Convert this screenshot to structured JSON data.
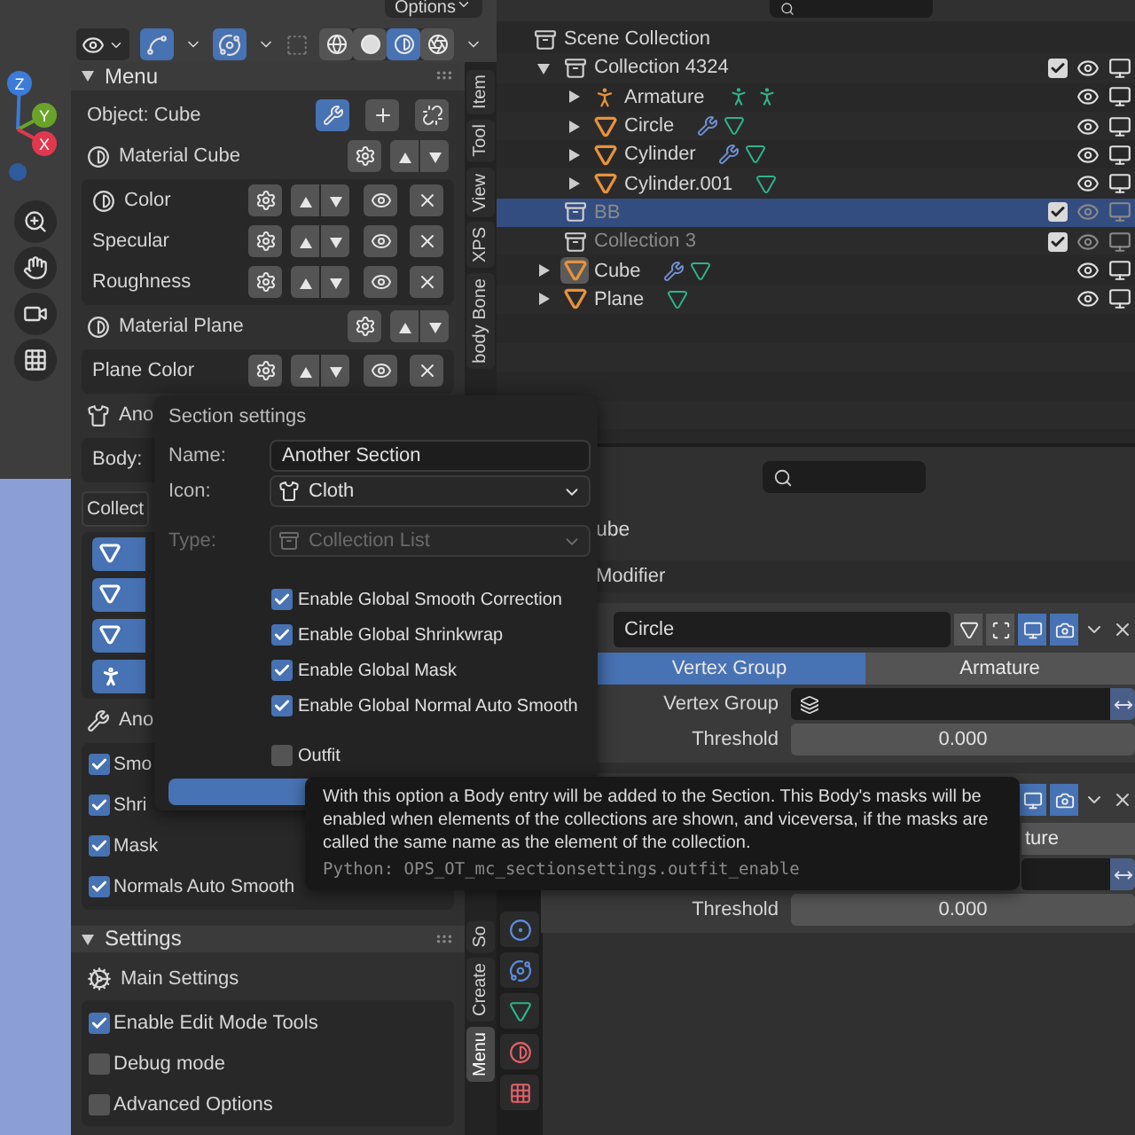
{
  "viewport": {
    "options_button": "Options",
    "shading_modes": [
      {
        "kind": "wireframe",
        "selected": false
      },
      {
        "kind": "solid",
        "selected": false
      },
      {
        "kind": "material",
        "selected": true
      },
      {
        "kind": "rendered",
        "selected": false
      }
    ],
    "gizmo_axes": [
      "Z",
      "Y",
      "X"
    ]
  },
  "n_panel": {
    "tabs_top": [
      {
        "label": "Item",
        "selected": false
      },
      {
        "label": "Tool",
        "selected": false
      },
      {
        "label": "View",
        "selected": false
      },
      {
        "label": "XPS",
        "selected": false
      },
      {
        "label": "body Bone",
        "selected": false
      }
    ],
    "tabs_bottom": [
      {
        "label": "So",
        "selected": false
      },
      {
        "label": "Create",
        "selected": false
      },
      {
        "label": "Menu",
        "selected": true
      }
    ],
    "menu_panel": {
      "title": "Menu",
      "expanded": true,
      "object_label": "Object: Cube",
      "object_buttons": [
        {
          "kind": "wrench",
          "on": true
        },
        {
          "kind": "add",
          "on": false
        },
        {
          "kind": "unlink",
          "on": false
        }
      ],
      "materials": [
        {
          "name": "Material Cube",
          "properties": [
            {
              "label": "Color",
              "kind": "material"
            },
            {
              "label": "Specular",
              "kind": "plain"
            },
            {
              "label": "Roughness",
              "kind": "plain"
            }
          ]
        },
        {
          "name": "Material Plane",
          "properties": [
            {
              "label": "Plane Color",
              "kind": "plain"
            }
          ]
        }
      ],
      "section_label": "Ano",
      "body_label": "Body:",
      "collection_button": "Collect",
      "collection_items": [
        {
          "kind": "mesh",
          "on": true
        },
        {
          "kind": "mesh",
          "on": true
        },
        {
          "kind": "mesh",
          "on": true
        },
        {
          "kind": "armature",
          "on": true
        }
      ],
      "global_label": "Ano",
      "global_options": [
        {
          "label": "Smo",
          "checked": true
        },
        {
          "label": "Shri",
          "checked": true
        },
        {
          "label": "Mask",
          "checked": true
        },
        {
          "label": "Normals Auto Smooth",
          "checked": true
        }
      ]
    },
    "settings_panel": {
      "title": "Settings",
      "expanded": true,
      "subtitle": "Main Settings",
      "options": [
        {
          "label": "Enable Edit Mode Tools",
          "checked": true
        },
        {
          "label": "Debug mode",
          "checked": false
        },
        {
          "label": "Advanced Options",
          "checked": false
        }
      ]
    }
  },
  "outliner": {
    "tree": [
      {
        "name": "Scene Collection",
        "kind": "scene",
        "selected": false,
        "children": [
          {
            "name": "Collection 4324",
            "kind": "collection",
            "expanded": true,
            "checked": true,
            "selected": false,
            "dimmed": false,
            "children": [
              {
                "name": "Armature",
                "kind": "armature",
                "expanded": false,
                "selected": false,
                "active": false,
                "extras": [
                  {
                    "kind": "armature"
                  },
                  {
                    "kind": "armature"
                  }
                ]
              },
              {
                "name": "Circle",
                "kind": "mesh",
                "expanded": false,
                "selected": false,
                "active": false,
                "extras": [
                  {
                    "kind": "wrench"
                  },
                  {
                    "kind": "mesh"
                  }
                ]
              },
              {
                "name": "Cylinder",
                "kind": "mesh",
                "expanded": false,
                "selected": false,
                "active": false,
                "extras": [
                  {
                    "kind": "wrench"
                  },
                  {
                    "kind": "mesh"
                  }
                ]
              },
              {
                "name": "Cylinder.001",
                "kind": "mesh",
                "expanded": false,
                "selected": false,
                "active": false,
                "extras": [
                  {
                    "kind": "mesh"
                  }
                ]
              }
            ]
          },
          {
            "name": "BB",
            "kind": "collection",
            "checked": true,
            "selected": true,
            "dimmed": true
          },
          {
            "name": "Collection 3",
            "kind": "collection",
            "checked": true,
            "selected": false,
            "dimmed": true
          },
          {
            "name": "Cube",
            "kind": "mesh",
            "expanded": false,
            "selected": false,
            "active": true,
            "extras": [
              {
                "kind": "wrench"
              },
              {
                "kind": "mesh"
              }
            ]
          },
          {
            "name": "Plane",
            "kind": "mesh",
            "expanded": false,
            "selected": false,
            "active": false,
            "extras": [
              {
                "kind": "mesh"
              }
            ]
          }
        ]
      }
    ]
  },
  "properties": {
    "object_name": "ube",
    "add_button": "Modifier",
    "modifier": {
      "name": "Circle",
      "toggles": [
        {
          "kind": "funnel",
          "on": false
        },
        {
          "kind": "cage",
          "on": false
        },
        {
          "kind": "viewport",
          "on": true
        },
        {
          "kind": "render",
          "on": true
        }
      ],
      "tabs": [
        {
          "label": "Vertex Group",
          "selected": true
        },
        {
          "label": "Armature",
          "selected": false
        }
      ],
      "vertex_group_label": "Vertex Group",
      "threshold_label": "Threshold",
      "threshold_value": "0.000"
    },
    "modifier_2": {
      "toggles": [
        {
          "kind": "viewport",
          "on": true
        },
        {
          "kind": "render",
          "on": true
        }
      ],
      "tab": {
        "label": "ture",
        "selected": false
      },
      "threshold_label": "Threshold",
      "threshold_value": "0.000"
    }
  },
  "section_popup": {
    "title": "Section settings",
    "name_label": "Name:",
    "name_value": "Another Section",
    "icon_label": "Icon:",
    "icon_value": "Cloth",
    "type_label": "Type:",
    "type_value": "Collection List",
    "type_disabled": true,
    "options": [
      {
        "label": "Enable Global Smooth Correction",
        "checked": true
      },
      {
        "label": "Enable Global Shrinkwrap",
        "checked": true
      },
      {
        "label": "Enable Global Mask",
        "checked": true
      },
      {
        "label": "Enable Global Normal Auto Smooth",
        "checked": true
      }
    ],
    "outfit": {
      "label": "Outfit",
      "checked": false
    }
  },
  "tooltip": {
    "text": "With this option a Body entry will be added to the Section. This Body's masks will be enabled when elements of the collections are shown, and viceversa, if the masks are called the same name as the element of the collection.",
    "python": "Python: OPS_OT_mc_sectionsettings.outfit_enable"
  }
}
